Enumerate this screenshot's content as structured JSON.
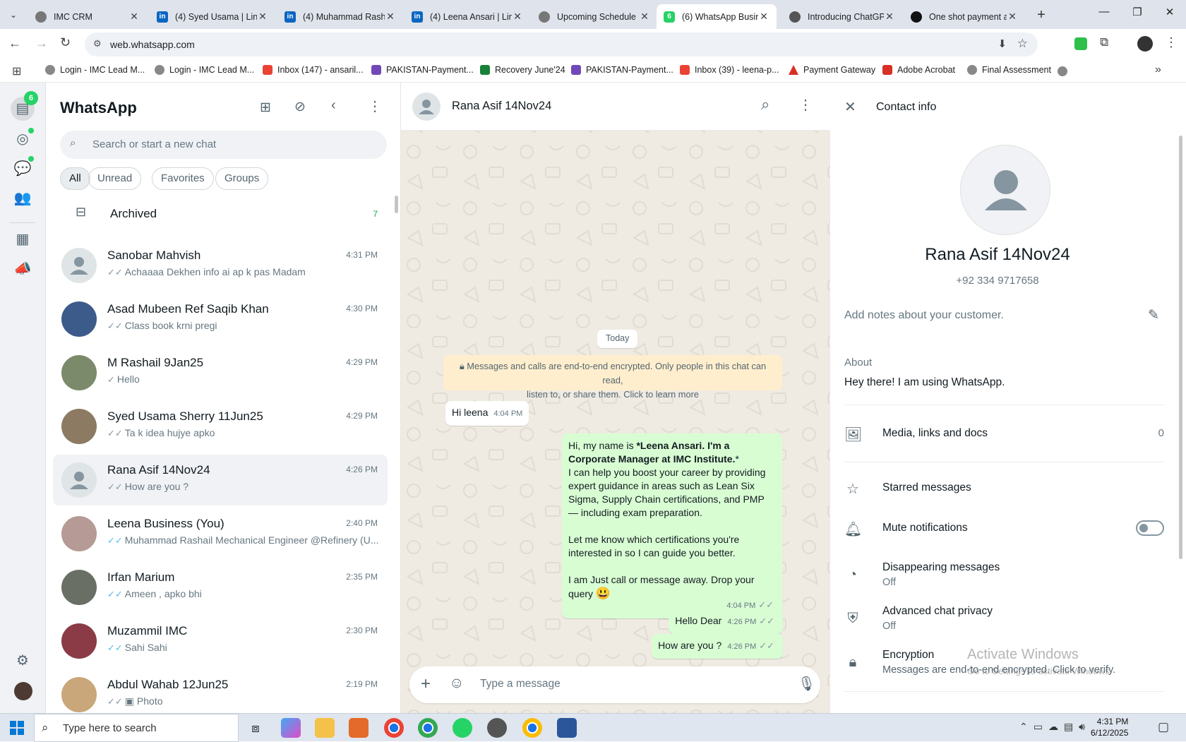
{
  "browser": {
    "tabs": [
      {
        "title": "IMC CRM",
        "color": "#5f6368"
      },
      {
        "title": "(4) Syed Usama | Lin",
        "color": "#0a66c2"
      },
      {
        "title": "(4) Muhammad Rash",
        "color": "#0a66c2"
      },
      {
        "title": "(4) Leena Ansari | Lin",
        "color": "#0a66c2"
      },
      {
        "title": "Upcoming Schedule",
        "color": "#5f6368"
      },
      {
        "title": "(6) WhatsApp Busin",
        "color": "#25d366",
        "badge": "6"
      },
      {
        "title": "Introducing ChatGP",
        "color": "#5f6368"
      },
      {
        "title": "One shot payment a",
        "color": "#111111"
      }
    ],
    "url": "web.whatsapp.com",
    "bookmarks": [
      {
        "label": "Login - IMC Lead M...",
        "color": "#5f6368"
      },
      {
        "label": "Login - IMC Lead M...",
        "color": "#5f6368"
      },
      {
        "label": "Inbox (147) - ansaril...",
        "color": "#ea4335"
      },
      {
        "label": "PAKISTAN-Payment...",
        "color": "#7248b9"
      },
      {
        "label": "Recovery June'24",
        "color": "#188038"
      },
      {
        "label": "PAKISTAN-Payment...",
        "color": "#7248b9"
      },
      {
        "label": "Inbox (39) - leena-p...",
        "color": "#ea4335"
      },
      {
        "label": "Payment Gateway",
        "color": "#d93025"
      },
      {
        "label": "Adobe Acrobat",
        "color": "#d93025"
      },
      {
        "label": "Final Assessment",
        "color": "#5f6368"
      }
    ]
  },
  "rail": {
    "badge": "6"
  },
  "sidebar": {
    "title": "WhatsApp",
    "search_placeholder": "Search or start a new chat",
    "filters": [
      "All",
      "Unread",
      "Favorites",
      "Groups"
    ],
    "archived_label": "Archived",
    "archived_count": "7",
    "chats": [
      {
        "name": "Sanobar Mahvish",
        "time": "4:31 PM",
        "tick": "✓✓",
        "tick_color": "gray",
        "preview": "Achaaaa  Dekhen info ai ap k pas Madam",
        "avatar": "default"
      },
      {
        "name": "Asad Mubeen Ref Saqib Khan",
        "time": "4:30 PM",
        "tick": "✓✓",
        "tick_color": "gray",
        "preview": "Class book krni pregi",
        "avatar": "#3c5a8a"
      },
      {
        "name": "M Rashail 9Jan25",
        "time": "4:29 PM",
        "tick": "✓",
        "tick_color": "gray",
        "preview": "Hello",
        "avatar": "#7b8a6b"
      },
      {
        "name": "Syed Usama Sherry 11Jun25",
        "time": "4:29 PM",
        "tick": "✓✓",
        "tick_color": "gray",
        "preview": "Ta k idea hujye apko",
        "avatar": "#8c7a62"
      },
      {
        "name": "Rana Asif 14Nov24",
        "time": "4:26 PM",
        "tick": "✓✓",
        "tick_color": "gray",
        "preview": "How are you ?",
        "avatar": "default",
        "selected": true
      },
      {
        "name": "Leena Business (You)",
        "time": "2:40 PM",
        "tick": "✓✓",
        "tick_color": "blue",
        "preview": "Muhammad Rashail Mechanical Engineer @Refinery (U...",
        "avatar": "#b59a95"
      },
      {
        "name": "Irfan Marium",
        "time": "2:35 PM",
        "tick": "✓✓",
        "tick_color": "blue",
        "preview": "Ameen , apko bhi",
        "avatar": "#6a6f66"
      },
      {
        "name": "Muzammil IMC",
        "time": "2:30 PM",
        "tick": "✓✓",
        "tick_color": "blue",
        "preview": "Sahi Sahi",
        "avatar": "#8a3b45"
      },
      {
        "name": "Abdul Wahab 12Jun25",
        "time": "2:19 PM",
        "tick": "✓✓",
        "tick_color": "gray",
        "preview": "▣ Photo",
        "avatar": "#c9a77a"
      }
    ]
  },
  "chat": {
    "contact_name": "Rana Asif 14Nov24",
    "date_chip": "Today",
    "encryption_notice_1": "Messages and calls are end-to-end encrypted. Only people in this chat can read,",
    "encryption_notice_2": "listen to, or share them. Click to learn more",
    "msg_in": {
      "text": "Hi leena",
      "time": "4:04 PM"
    },
    "msg_long": {
      "line1a": "Hi, my name is ",
      "line1b": "*Leena Ansari. I'm a",
      "line2": "Corporate Manager at IMC Institute.",
      "line2b": "*",
      "p1": "I can help you boost your career by providing expert guidance in areas such as Lean Six Sigma, Supply Chain certifications, and PMP — including exam preparation.",
      "p2": "Let me know which certifications you're interested in so I can guide you better.",
      "p3": "I am Just call or message away. Drop your query",
      "emoji": "😃",
      "time": "4:04 PM"
    },
    "msg_hello": {
      "text": "Hello Dear",
      "time": "4:26 PM"
    },
    "msg_how": {
      "text": "How are you ?",
      "time": "4:26 PM"
    },
    "compose_placeholder": "Type a message"
  },
  "contact_info": {
    "header": "Contact info",
    "name": "Rana Asif 14Nov24",
    "phone": "+92 334 9717658",
    "notes_placeholder": "Add notes about your customer.",
    "about_label": "About",
    "about_text": "Hey there! I am using WhatsApp.",
    "media_label": "Media, links and docs",
    "media_count": "0",
    "starred_label": "Starred messages",
    "mute_label": "Mute notifications",
    "disappearing_label": "Disappearing messages",
    "disappearing_value": "Off",
    "privacy_label": "Advanced chat privacy",
    "privacy_value": "Off",
    "encryption_label": "Encryption",
    "encryption_value": "Messages are end-to-end encrypted. Click to verify."
  },
  "watermark": {
    "line1": "Activate Windows",
    "line2": "Go to Settings to activate Windows."
  },
  "taskbar": {
    "search_placeholder": "Type here to search",
    "time": "4:31 PM",
    "date": "6/12/2025"
  }
}
